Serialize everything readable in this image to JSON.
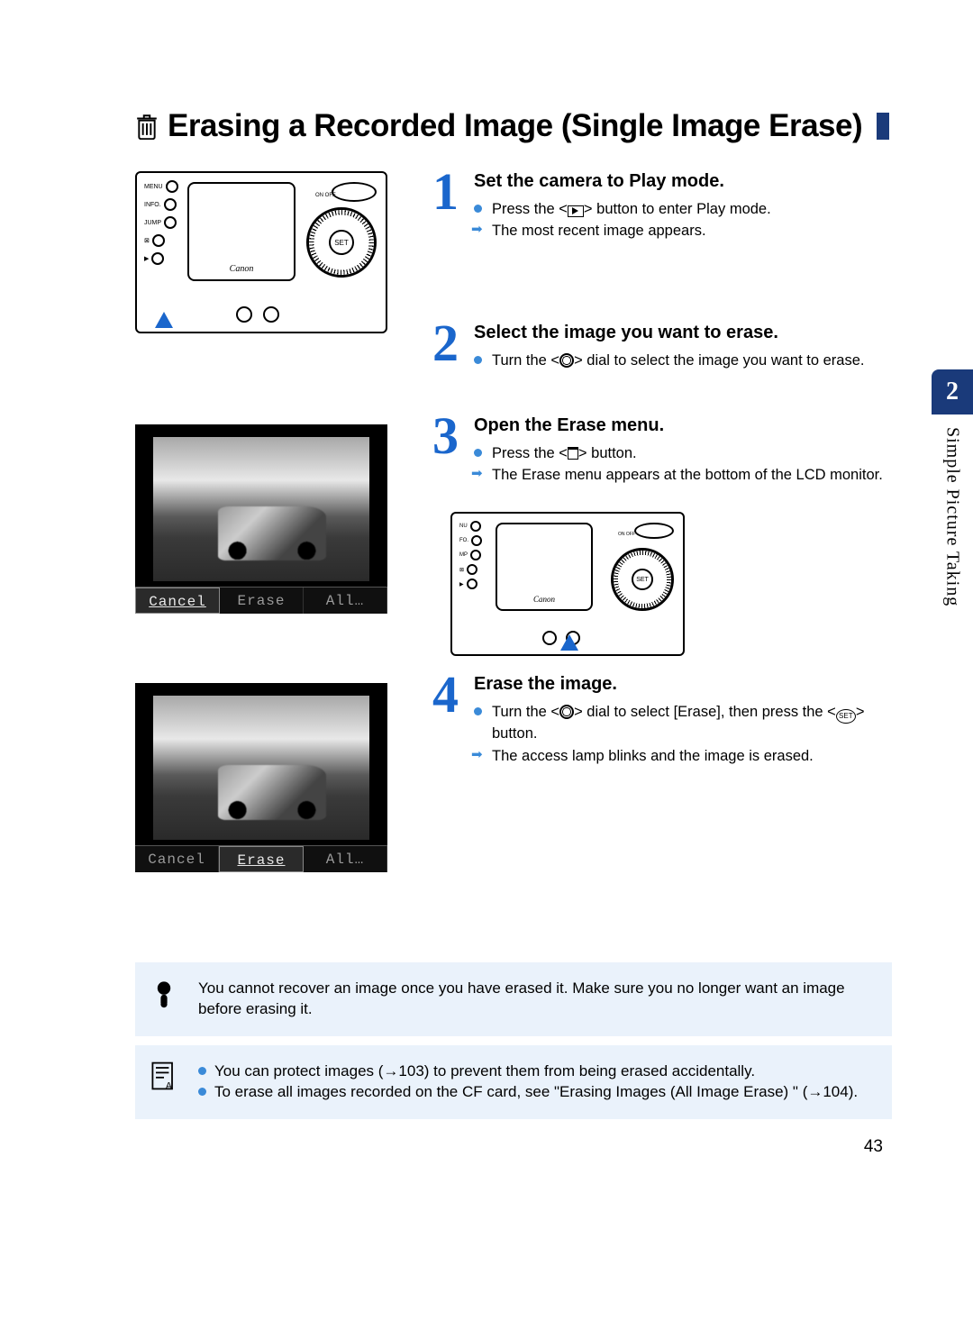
{
  "title": "Erasing a Recorded Image (Single Image Erase)",
  "sideTab": {
    "num": "2",
    "label": "Simple Picture Taking"
  },
  "pageNumber": "43",
  "camera": {
    "btnMenu": "MENU",
    "btnInfo": "INFO.",
    "btnJump": "JUMP",
    "brand": "Canon",
    "set": "SET",
    "onoff": "ON  OFF"
  },
  "steps": [
    {
      "num": "1",
      "title": "Set the camera to Play mode.",
      "lines": [
        {
          "type": "bullet",
          "pre": "Press the <",
          "icon": "play",
          "post": "> button to enter Play mode."
        },
        {
          "type": "arrow",
          "text": "The most recent image appears."
        }
      ]
    },
    {
      "num": "2",
      "title": "Select the image you want to erase.",
      "lines": [
        {
          "type": "bullet",
          "pre": "Turn the <",
          "icon": "dial",
          "post": "> dial to select the image you want to erase."
        }
      ]
    },
    {
      "num": "3",
      "title": "Open the Erase menu.",
      "lines": [
        {
          "type": "bullet",
          "pre": "Press the <",
          "icon": "trash",
          "post": "> button."
        },
        {
          "type": "arrow",
          "text": "The Erase menu appears at the bottom of the LCD monitor."
        }
      ]
    },
    {
      "num": "4",
      "title": "Erase the image.",
      "lines": [
        {
          "type": "bullet",
          "pre": "Turn the <",
          "icon": "dial",
          "mid": "> dial to select [Erase], then press the <",
          "icon2": "set",
          "post": "> button."
        },
        {
          "type": "arrow",
          "text": "The access lamp blinks and the image is erased."
        }
      ]
    }
  ],
  "lcd": {
    "cancel": "Cancel",
    "erase": "Erase",
    "all": "All…"
  },
  "notes": {
    "warn": "You cannot recover an image once you have erased it. Make sure you no longer want an image before erasing it.",
    "tip1": "You can protect images (→103) to prevent them from being erased accidentally.",
    "tip2": "To erase all images recorded on the CF card, see \"Erasing Images (All Image Erase) \" (→104)."
  }
}
